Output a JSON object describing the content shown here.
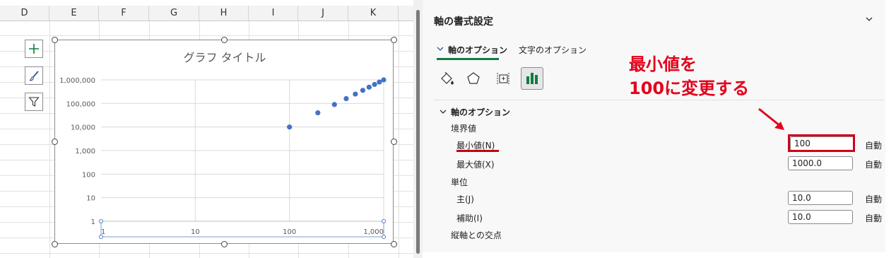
{
  "spreadsheet": {
    "columns": [
      "D",
      "E",
      "F",
      "G",
      "H",
      "I",
      "J",
      "K"
    ]
  },
  "chart": {
    "title": "グラフ タイトル"
  },
  "chart_data": {
    "type": "scatter",
    "title": "グラフ タイトル",
    "xlabel": "",
    "ylabel": "",
    "x_scale": "log",
    "y_scale": "log",
    "xlim": [
      1,
      1000
    ],
    "ylim": [
      1,
      1000000
    ],
    "x_ticks": [
      "1",
      "10",
      "100",
      "1,000"
    ],
    "y_ticks": [
      "1,000,000",
      "100,000",
      "10,000",
      "1,000",
      "100",
      "10",
      "1"
    ],
    "marker_color": "#4472c4",
    "series": [
      {
        "points": [
          {
            "x": 100,
            "y": 10000
          },
          {
            "x": 200,
            "y": 40000
          },
          {
            "x": 300,
            "y": 90000
          },
          {
            "x": 400,
            "y": 160000
          },
          {
            "x": 500,
            "y": 250000
          },
          {
            "x": 600,
            "y": 360000
          },
          {
            "x": 700,
            "y": 490000
          },
          {
            "x": 800,
            "y": 640000
          },
          {
            "x": 900,
            "y": 810000
          },
          {
            "x": 1000,
            "y": 1000000
          }
        ]
      }
    ]
  },
  "panel": {
    "title": "軸の書式設定",
    "tabs": [
      {
        "label": "軸のオプション"
      },
      {
        "label": "文字のオプション"
      }
    ],
    "section_title": "軸のオプション",
    "bounds_label": "境界値",
    "min_label": "最小値(N)",
    "min_value": "100",
    "max_label": "最大値(X)",
    "max_value": "1000.0",
    "units_label": "単位",
    "major_label": "主(J)",
    "major_value": "10.0",
    "minor_label": "補助(I)",
    "minor_value": "10.0",
    "auto_label": "自動",
    "cross_label": "縦軸との交点"
  },
  "annotation": {
    "line1": "最小値を",
    "line2": "100に変更する",
    "color": "#e3001b"
  }
}
